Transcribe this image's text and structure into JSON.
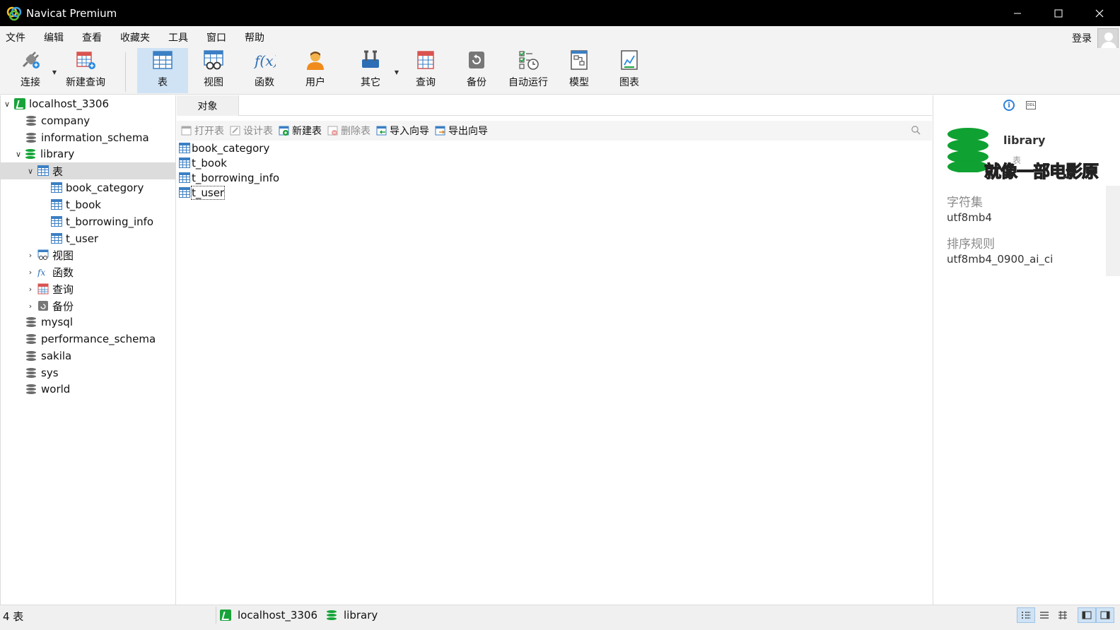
{
  "window": {
    "title": "Navicat Premium"
  },
  "menu": [
    "文件",
    "编辑",
    "查看",
    "收藏夹",
    "工具",
    "窗口",
    "帮助"
  ],
  "login": {
    "label": "登录"
  },
  "toolbar": {
    "connect": "连接",
    "new_query": "新建查询",
    "table": "表",
    "view": "视图",
    "function": "函数",
    "user": "用户",
    "other": "其它",
    "query": "查询",
    "backup": "备份",
    "auto_run": "自动运行",
    "model": "模型",
    "chart": "图表"
  },
  "tree": {
    "connection": "localhost_3306",
    "databases_before": [
      "company",
      "information_schema"
    ],
    "library": "library",
    "tables_group": "表",
    "tables": [
      "book_category",
      "t_book",
      "t_borrowing_info",
      "t_user"
    ],
    "views": "视图",
    "functions": "函数",
    "queries": "查询",
    "backups": "备份",
    "databases_after": [
      "mysql",
      "performance_schema",
      "sakila",
      "sys",
      "world"
    ]
  },
  "center": {
    "tab": "对象",
    "actions": {
      "open": "打开表",
      "design": "设计表",
      "new": "新建表",
      "delete": "删除表",
      "import": "导入向导",
      "export": "导出向导"
    },
    "objects": [
      "book_category",
      "t_book",
      "t_borrowing_info",
      "t_user"
    ]
  },
  "right_panel": {
    "name": "library",
    "type": "表",
    "overlay": "就像一部电影原",
    "charset_label": "字符集",
    "charset": "utf8mb4",
    "collation_label": "排序规则",
    "collation": "utf8mb4_0900_ai_ci"
  },
  "status": {
    "count": "4 表",
    "connection": "localhost_3306",
    "database": "library"
  },
  "colors": {
    "accent": "#cfe3f5",
    "db_green": "#13a538",
    "table_blue": "#3b7fc4"
  }
}
